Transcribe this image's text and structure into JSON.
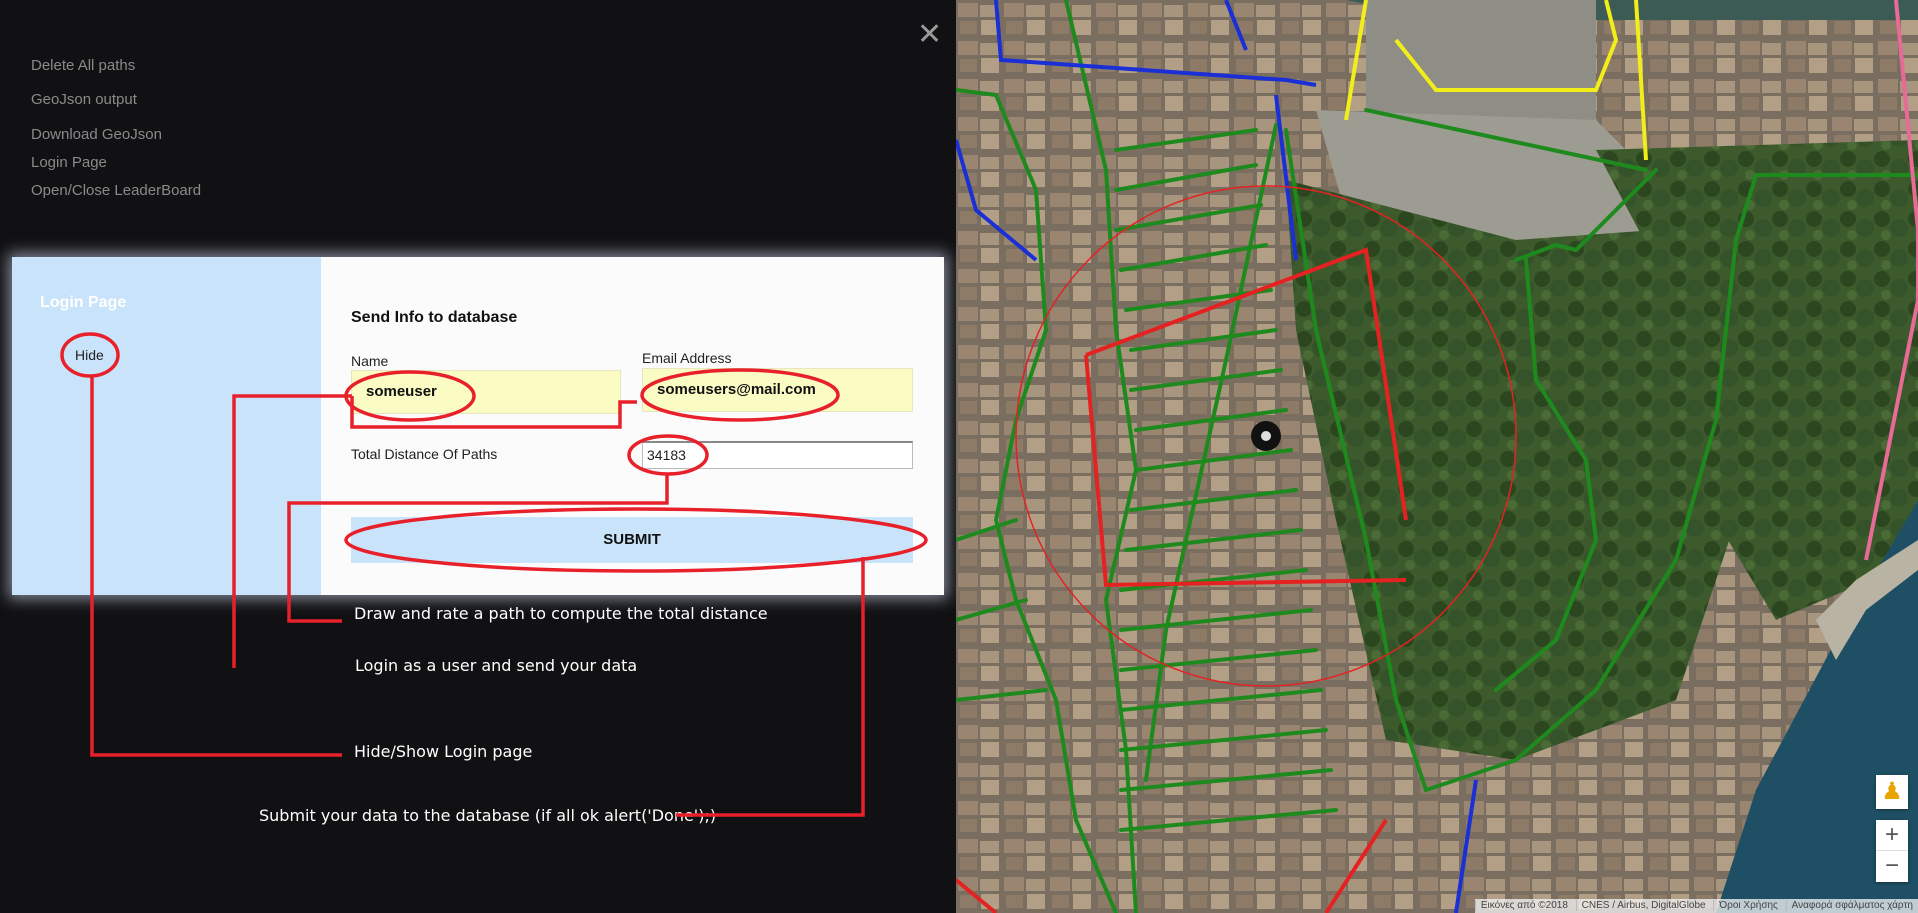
{
  "menu": {
    "items": [
      {
        "label": "Delete All paths"
      },
      {
        "label": "GeoJson output"
      },
      {
        "label": "Download GeoJson"
      },
      {
        "label": "Login Page"
      },
      {
        "label": "Open/Close LeaderBoard"
      }
    ],
    "close_symbol": "✕"
  },
  "login_page": {
    "side_title": "Login Page",
    "hide_label": "Hide",
    "form_title": "Send Info to database",
    "name_label": "Name",
    "name_value": "someuser",
    "email_label": "Email Address",
    "email_value": "someusers@mail.com",
    "distance_label": "Total Distance Of Paths",
    "distance_value": "34183",
    "submit_label": "SUBMIT"
  },
  "annotations": {
    "draw_note": "Draw and rate a path to compute the total distance",
    "login_note": "Login as a user and send your data",
    "hide_note": "Hide/Show Login page",
    "submit_note": "Submit your data to the database (if all ok alert('Done');)"
  },
  "map": {
    "attribution": [
      "Εικόνες από ©2018",
      "CNES / Airbus, DigitalGlobe",
      "Όροι Χρήσης",
      "Αναφορά σφάλματος χάρτη"
    ],
    "zoom_in": "+",
    "zoom_out": "−",
    "pegman_icon": "street-view-pegman-icon"
  },
  "colors": {
    "background": "#111113",
    "annotation_red": "#e8202a",
    "panel_blue": "#c9e3fb",
    "input_yellow": "#fbfbc4",
    "path_green": "#1e8a1e",
    "path_blue": "#1a2fd6",
    "path_yellow": "#f1ee1a",
    "path_pink": "#e86a96",
    "path_red": "#e52222"
  }
}
